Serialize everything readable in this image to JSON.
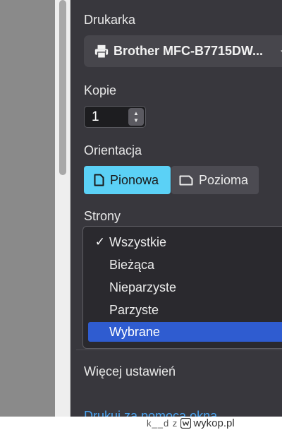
{
  "printer": {
    "label": "Drukarka",
    "name": "Brother MFC-B7715DW...",
    "icon": "printer-icon"
  },
  "copies": {
    "label": "Kopie",
    "value": "1"
  },
  "orientation": {
    "label": "Orientacja",
    "options": [
      {
        "label": "Pionowa",
        "selected": true
      },
      {
        "label": "Pozioma",
        "selected": false
      }
    ]
  },
  "pages": {
    "label": "Strony",
    "selected": "Wszystkie",
    "highlighted": "Wybrane",
    "options": [
      "Wszystkie",
      "Bieżąca",
      "Nieparzyste",
      "Parzyste",
      "Wybrane"
    ]
  },
  "more_settings": "Więcej ustawień",
  "system_dialog_link": "Drukuj za pomocą okna",
  "watermark": {
    "user": "k__d z",
    "site": "wykop.pl"
  },
  "colors": {
    "panel_bg": "#38373d",
    "accent": "#5bd1f6",
    "highlight": "#2f5cd0",
    "link": "#4aa3f0"
  }
}
